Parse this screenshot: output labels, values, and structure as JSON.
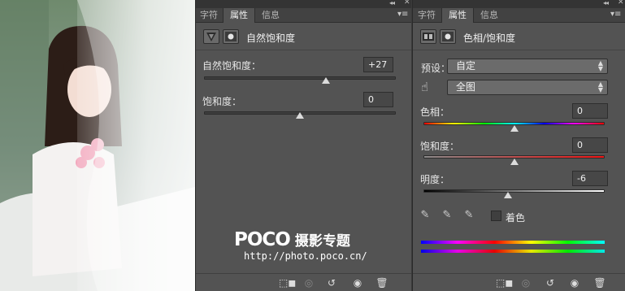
{
  "panel1": {
    "tabs": [
      "字符",
      "属性",
      "信息"
    ],
    "header_title": "自然饱和度",
    "vibrance": {
      "label": "自然饱和度：",
      "value": "+27",
      "level": 0.635
    },
    "saturation": {
      "label": "饱和度：",
      "value": "0",
      "level": 0.5
    }
  },
  "panel2": {
    "tabs": [
      "字符",
      "属性",
      "信息"
    ],
    "header_title": "色相/饱和度",
    "preset": {
      "label": "预设：",
      "value": "自定"
    },
    "channel": {
      "value": "全图"
    },
    "hue": {
      "label": "色相：",
      "value": "0",
      "level": 0.5
    },
    "saturation": {
      "label": "饱和度：",
      "value": "0",
      "level": 0.5
    },
    "lightness": {
      "label": "明度：",
      "value": "-6",
      "level": 0.465
    },
    "colorize": {
      "label": "着色",
      "checked": false
    }
  },
  "watermark": {
    "logo": "POCO",
    "subtitle": "摄影专题",
    "url": "http://photo.poco.cn/"
  },
  "colors": {
    "panel_bg": "#535353",
    "tab_bg": "#424242",
    "accent_text": "#e4e4e4"
  }
}
